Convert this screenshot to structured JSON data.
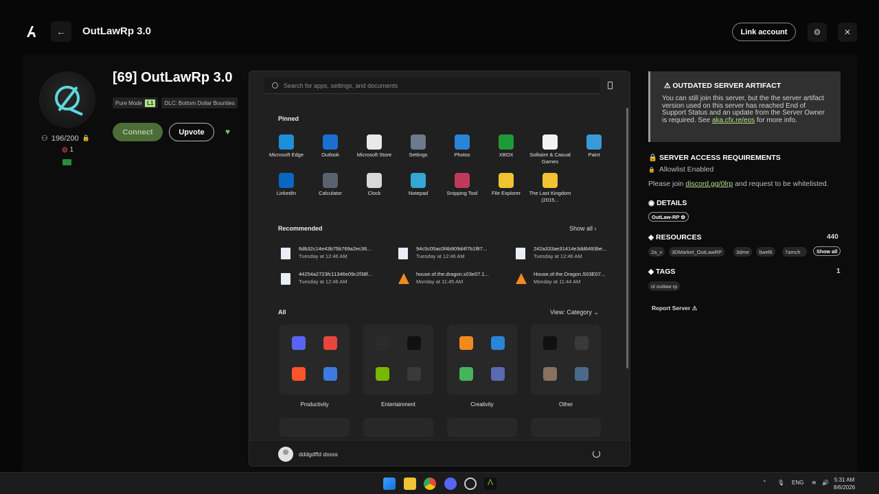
{
  "header": {
    "title": "OutLawRp 3.0",
    "link_account": "Link account"
  },
  "server": {
    "title": "[69] OutLawRp 3.0",
    "players": "196/200",
    "ping": "1",
    "mode_badge": "Pure Mode",
    "level": "L1",
    "dlc_badge": "DLC: Bottom Dollar Bounties",
    "connect": "Connect",
    "upvote": "Upvote"
  },
  "start_menu": {
    "search_placeholder": "Search for apps, settings, and documents",
    "pinned_label": "Pinned",
    "pinned": [
      {
        "label": "Microsoft Edge",
        "icon": "edge-icon",
        "color": "#1d8fd8"
      },
      {
        "label": "Outlook",
        "icon": "outlook-icon",
        "color": "#1a6fd1"
      },
      {
        "label": "Microsoft Store",
        "icon": "store-icon",
        "color": "#e9e9e9"
      },
      {
        "label": "Settings",
        "icon": "settings-icon",
        "color": "#6b7b8c"
      },
      {
        "label": "Photos",
        "icon": "photos-icon",
        "color": "#2a84d8"
      },
      {
        "label": "XBOX",
        "icon": "xbox-icon",
        "color": "#1f9a38"
      },
      {
        "label": "Solitaire & Casual Games",
        "icon": "solitaire-icon",
        "color": "#f2f2f2"
      },
      {
        "label": "Paint",
        "icon": "paint-icon",
        "color": "#3a9ad9"
      },
      {
        "label": "LinkedIn",
        "icon": "linkedin-icon",
        "color": "#0a66c2"
      },
      {
        "label": "Calculator",
        "icon": "calculator-icon",
        "color": "#59636e"
      },
      {
        "label": "Clock",
        "icon": "clock-icon",
        "color": "#d8d8d8"
      },
      {
        "label": "Notepad",
        "icon": "notepad-icon",
        "color": "#35a7d4"
      },
      {
        "label": "Snipping Tool",
        "icon": "snipping-tool-icon",
        "color": "#c0395a"
      },
      {
        "label": "File Explorer",
        "icon": "file-explorer-icon",
        "color": "#f1c232"
      },
      {
        "label": "The Last Kingdom (2015...",
        "icon": "folder-icon",
        "color": "#f1c232"
      }
    ],
    "recommended_label": "Recommended",
    "show_all": "Show all  ›",
    "recommended": [
      {
        "name": "6db32c14e43b75b769a2ec36...",
        "time": "Tuesday at 12:46 AM",
        "type": "image"
      },
      {
        "name": "94c5c05ac0f4b909d4f7b1f87...",
        "time": "Tuesday at 12:46 AM",
        "type": "image"
      },
      {
        "name": "242a333ae31414e3dd6493be...",
        "time": "Tuesday at 12:46 AM",
        "type": "image"
      },
      {
        "name": "44254a2723fc11346e09c2f38f...",
        "time": "Tuesday at 12:46 AM",
        "type": "image"
      },
      {
        "name": "house.of.the.dragon.s03e07.1...",
        "time": "Monday at 11:45 AM",
        "type": "video"
      },
      {
        "name": "House.of.the.Dragon.S03E07...",
        "time": "Monday at 11:44 AM",
        "type": "video"
      }
    ],
    "all_label": "All",
    "view_label": "View: Category  ⌄",
    "categories": [
      {
        "label": "Productivity",
        "icons": [
          "discord-icon",
          "chrome-icon",
          "brave-icon",
          "office-apps-icon"
        ],
        "colors": [
          "#5865f2",
          "#e8453c",
          "#fb542b",
          "#3d7be0"
        ]
      },
      {
        "label": "Entertainment",
        "icons": [
          "epic-games-icon",
          "tiktok-icon",
          "nvidia-icon",
          "media-player-icon"
        ],
        "colors": [
          "#2b2b2b",
          "#111111",
          "#76b900",
          "#3a3a3a"
        ]
      },
      {
        "label": "Creativity",
        "icons": [
          "vlc-icon",
          "photos-icon",
          "bluestacks-icon",
          "media-editor-icon"
        ],
        "colors": [
          "#f08a1c",
          "#2a84d8",
          "#45b45a",
          "#5a6ab0"
        ]
      },
      {
        "label": "Other",
        "icons": [
          "altv-icon",
          "obs-icon",
          "game-thumb-icon",
          "tools-icon"
        ],
        "colors": [
          "#111111",
          "#3a3a3a",
          "#8a7060",
          "#4a6a8a"
        ]
      }
    ],
    "user": "dddgdffd dssss"
  },
  "details": {
    "warning_title": "OUTDATED SERVER ARTIFACT",
    "warning_text": "You can still join this server, but the the server artifact version used on this server has reached End of Support Status and an update from the Server Owner is required. See ",
    "warning_link": "aka.cfx.re/eos",
    "warning_tail": " for more info.",
    "access_heading": "SERVER ACCESS REQUIREMENTS",
    "allowlist": "Allowlist Enabled",
    "join_pre": "Please join ",
    "join_link": "discord.gg/0lrp",
    "join_post": " and request to be whitelisted.",
    "details_heading": "DETAILS",
    "details_pill": "OutLaw-RP",
    "resources_heading": "RESOURCES",
    "resources_count": "440",
    "resources": [
      "2a_v",
      "3DMarket_OutLawRP",
      "3dme",
      "5wel6",
      "7amch"
    ],
    "resources_show_all": "Show all",
    "tags_heading": "TAGS",
    "tags_count": "1",
    "tags": [
      "ol outlaw rp"
    ],
    "report": "Report Server"
  },
  "taskbar": {
    "lang": "ENG",
    "time": "5:31 AM",
    "date": "8/6/2026"
  }
}
